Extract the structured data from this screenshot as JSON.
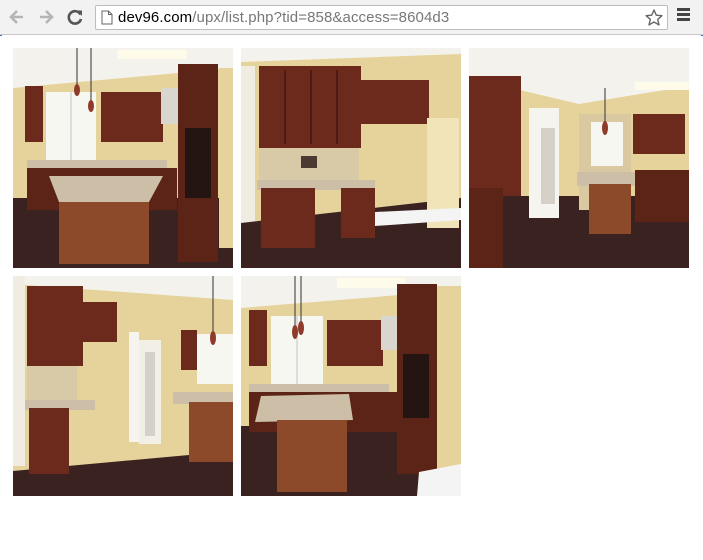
{
  "browser": {
    "url_host": "dev96.com",
    "url_path": "/upx/list.php?tid=858&access=8604d3",
    "back_icon": "back-arrow-icon",
    "forward_icon": "forward-arrow-icon",
    "reload_icon": "reload-icon",
    "page_icon": "page-icon",
    "bookmark_icon": "star-icon",
    "menu_icon": "hamburger-menu-icon"
  },
  "gallery": {
    "photos": [
      {
        "id": 1,
        "subject": "kitchen-photo"
      },
      {
        "id": 2,
        "subject": "kitchen-photo"
      },
      {
        "id": 3,
        "subject": "kitchen-photo"
      },
      {
        "id": 4,
        "subject": "kitchen-photo"
      },
      {
        "id": 5,
        "subject": "kitchen-photo"
      }
    ]
  },
  "colors": {
    "wall": "#e6d39c",
    "cabinet": "#6b2a1b",
    "floor": "#3a2220",
    "counter": "#cdbfa7",
    "window": "#f7f7f2",
    "ceiling": "#f4f2ec"
  }
}
